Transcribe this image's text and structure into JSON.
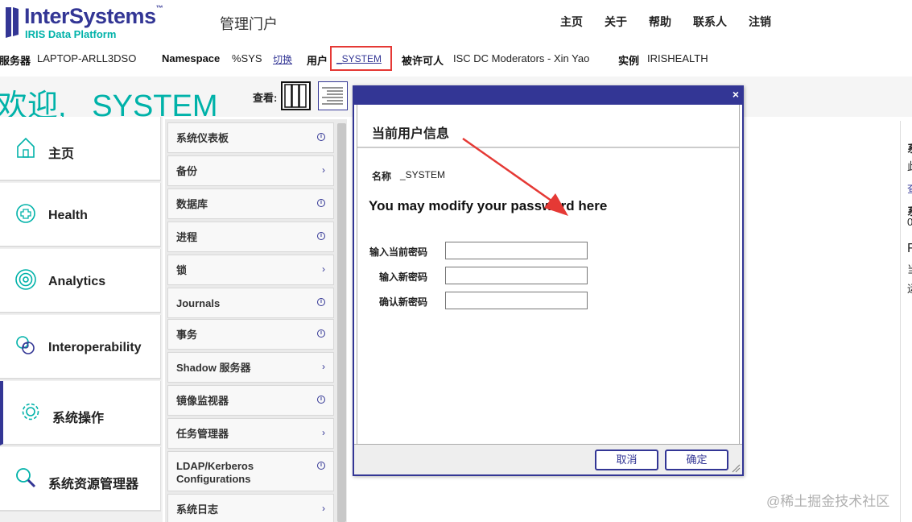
{
  "header": {
    "brand_name": "InterSystems",
    "brand_tm": "™",
    "brand_sub": "IRIS Data Platform",
    "portal_title": "管理门户",
    "nav": [
      "主页",
      "关于",
      "帮助",
      "联系人",
      "注销"
    ]
  },
  "info_bar": {
    "server_label": "服务器",
    "server_value": "LAPTOP-ARLL3DSO",
    "namespace_label": "Namespace",
    "namespace_value": "%SYS",
    "switch_label": "切换",
    "user_label": "用户",
    "user_value": "_SYSTEM",
    "licensee_label": "被许可人",
    "licensee_value": "ISC DC Moderators - Xin Yao",
    "instance_label": "实例",
    "instance_value": "IRISHEALTH"
  },
  "welcome": {
    "text": "欢迎, _SYSTEM",
    "view_label": "查看:"
  },
  "left_nav": [
    {
      "label": "主页",
      "icon": "home-icon"
    },
    {
      "label": "Health",
      "icon": "health-plus-icon"
    },
    {
      "label": "Analytics",
      "icon": "analytics-target-icon"
    },
    {
      "label": "Interoperability",
      "icon": "interoperability-rings-icon"
    },
    {
      "label": "系统操作",
      "icon": "gear-icon"
    },
    {
      "label": "系统资源管理器",
      "icon": "magnifier-icon"
    }
  ],
  "sub_menu": [
    {
      "label": "系统仪表板",
      "indicator": "info"
    },
    {
      "label": "备份",
      "indicator": "arrow"
    },
    {
      "label": "数据库",
      "indicator": "info"
    },
    {
      "label": "进程",
      "indicator": "info"
    },
    {
      "label": "锁",
      "indicator": "arrow"
    },
    {
      "label": "Journals",
      "indicator": "info"
    },
    {
      "label": "事务",
      "indicator": "info"
    },
    {
      "label": "Shadow 服务器",
      "indicator": "arrow"
    },
    {
      "label": "镜像监视器",
      "indicator": "info"
    },
    {
      "label": "任务管理器",
      "indicator": "arrow"
    },
    {
      "label": "LDAP/Kerberos Configurations",
      "indicator": "info"
    },
    {
      "label": "系统日志",
      "indicator": "arrow"
    }
  ],
  "right_fragments": [
    "系",
    "此",
    "查",
    "系",
    "0",
    "F",
    "当",
    "运"
  ],
  "dialog": {
    "close": "×",
    "title": "当前用户信息",
    "name_label": "名称",
    "name_value": "_SYSTEM",
    "message": "You may modify your password here",
    "fields": [
      {
        "label": "输入当前密码",
        "value": ""
      },
      {
        "label": "输入新密码",
        "value": ""
      },
      {
        "label": "确认新密码",
        "value": ""
      }
    ],
    "cancel_label": "取消",
    "ok_label": "确定"
  },
  "colors": {
    "brand": "#333695",
    "accent": "#00b2a9",
    "highlight_border": "#e53935",
    "arrow": "#e53935"
  },
  "watermark": "@稀土掘金技术社区"
}
